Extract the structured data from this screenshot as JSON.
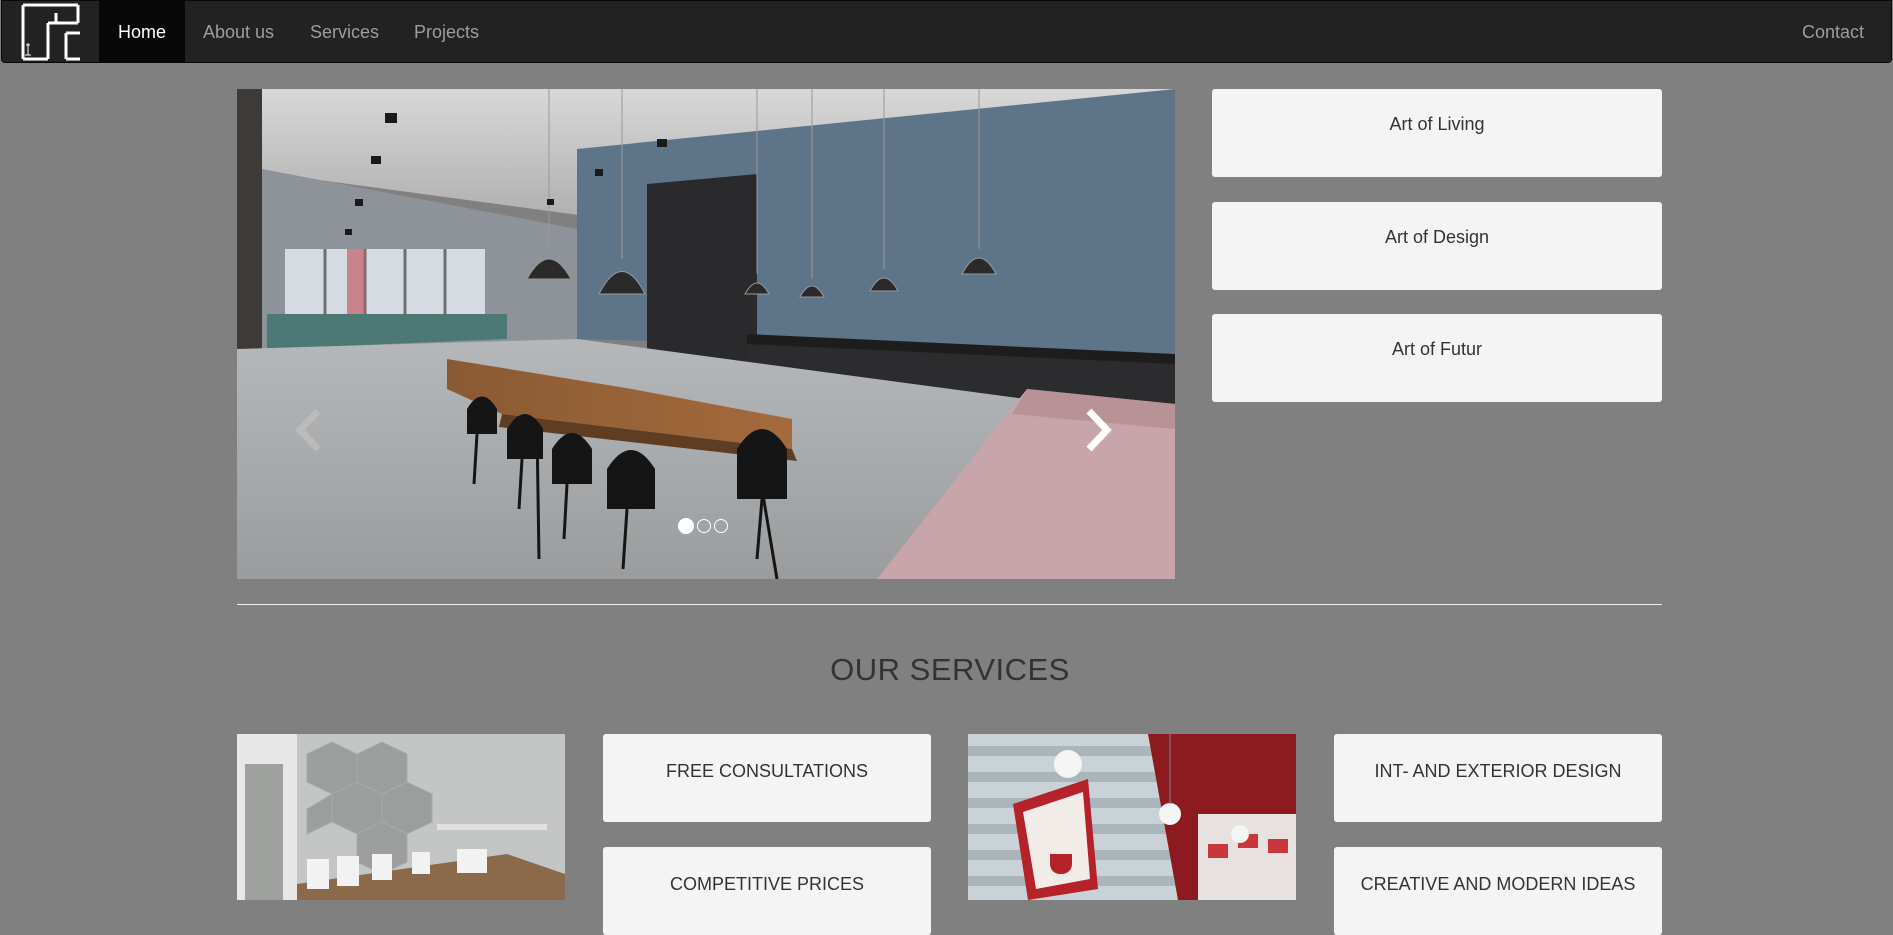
{
  "nav": {
    "logo_icon": "studio-logo",
    "items": [
      {
        "label": "Home",
        "active": true
      },
      {
        "label": "About us"
      },
      {
        "label": "Services"
      },
      {
        "label": "Projects"
      }
    ],
    "contact_label": "Contact"
  },
  "carousel": {
    "prev_icon": "chevron-left-icon",
    "next_icon": "chevron-right-icon",
    "slide_count": 3,
    "active_slide": 1
  },
  "features": [
    {
      "label": "Art of Living"
    },
    {
      "label": "Art of Design"
    },
    {
      "label": "Art of Futur"
    }
  ],
  "services": {
    "title": "OUR SERVICES",
    "items": [
      {
        "label": "FREE CONSULTATIONS"
      },
      {
        "label": "COMPETITIVE PRICES"
      },
      {
        "label": "INT- AND EXTERIOR DESIGN"
      },
      {
        "label": "CREATIVE AND MODERN IDEAS"
      }
    ]
  },
  "colors": {
    "page_bg": "#808080",
    "navbar_bg": "#222222",
    "box_bg": "#f4f4f4",
    "text": "#333333"
  }
}
